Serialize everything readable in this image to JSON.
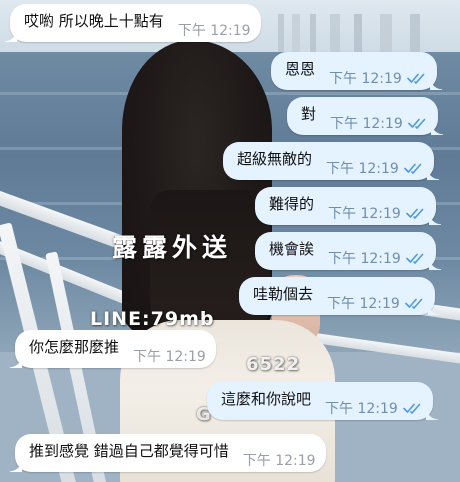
{
  "colors": {
    "incoming_bubble": "#ffffff",
    "outgoing_bubble": "#e5f2ff",
    "read_check": "#4c9be0",
    "incoming_time": "#9aa0a6",
    "outgoing_time": "#6f8faa"
  },
  "background": {
    "watermark_title": "露露外送",
    "watermark_line": "LINE:79mb",
    "watermark_tail": "6522",
    "watermark_tail2": "G"
  },
  "messages": [
    {
      "direction": "in",
      "text": "哎喲 所以晚上十點有",
      "time": "下午 12:19"
    },
    {
      "direction": "out",
      "text": "恩恩",
      "time": "下午 12:19",
      "status": "read-check-icon"
    },
    {
      "direction": "out",
      "text": "對",
      "time": "下午 12:19",
      "status": "read-check-icon"
    },
    {
      "direction": "out",
      "text": "超級無敵的",
      "time": "下午 12:19",
      "status": "read-check-icon"
    },
    {
      "direction": "out",
      "text": "難得的",
      "time": "下午 12:19",
      "status": "read-check-icon"
    },
    {
      "direction": "out",
      "text": "機會誒",
      "time": "下午 12:19",
      "status": "read-check-icon"
    },
    {
      "direction": "out",
      "text": "哇勒個去",
      "time": "下午 12:19",
      "status": "read-check-icon"
    },
    {
      "direction": "in",
      "text": "你怎麼那麼推",
      "time": "下午 12:19"
    },
    {
      "direction": "out",
      "text": "這麼和你說吧",
      "time": "下午 12:19",
      "status": "read-check-icon"
    },
    {
      "direction": "in",
      "text": "推到感覺 錯過自己都覺得可惜",
      "time": "下午 12:19"
    }
  ]
}
